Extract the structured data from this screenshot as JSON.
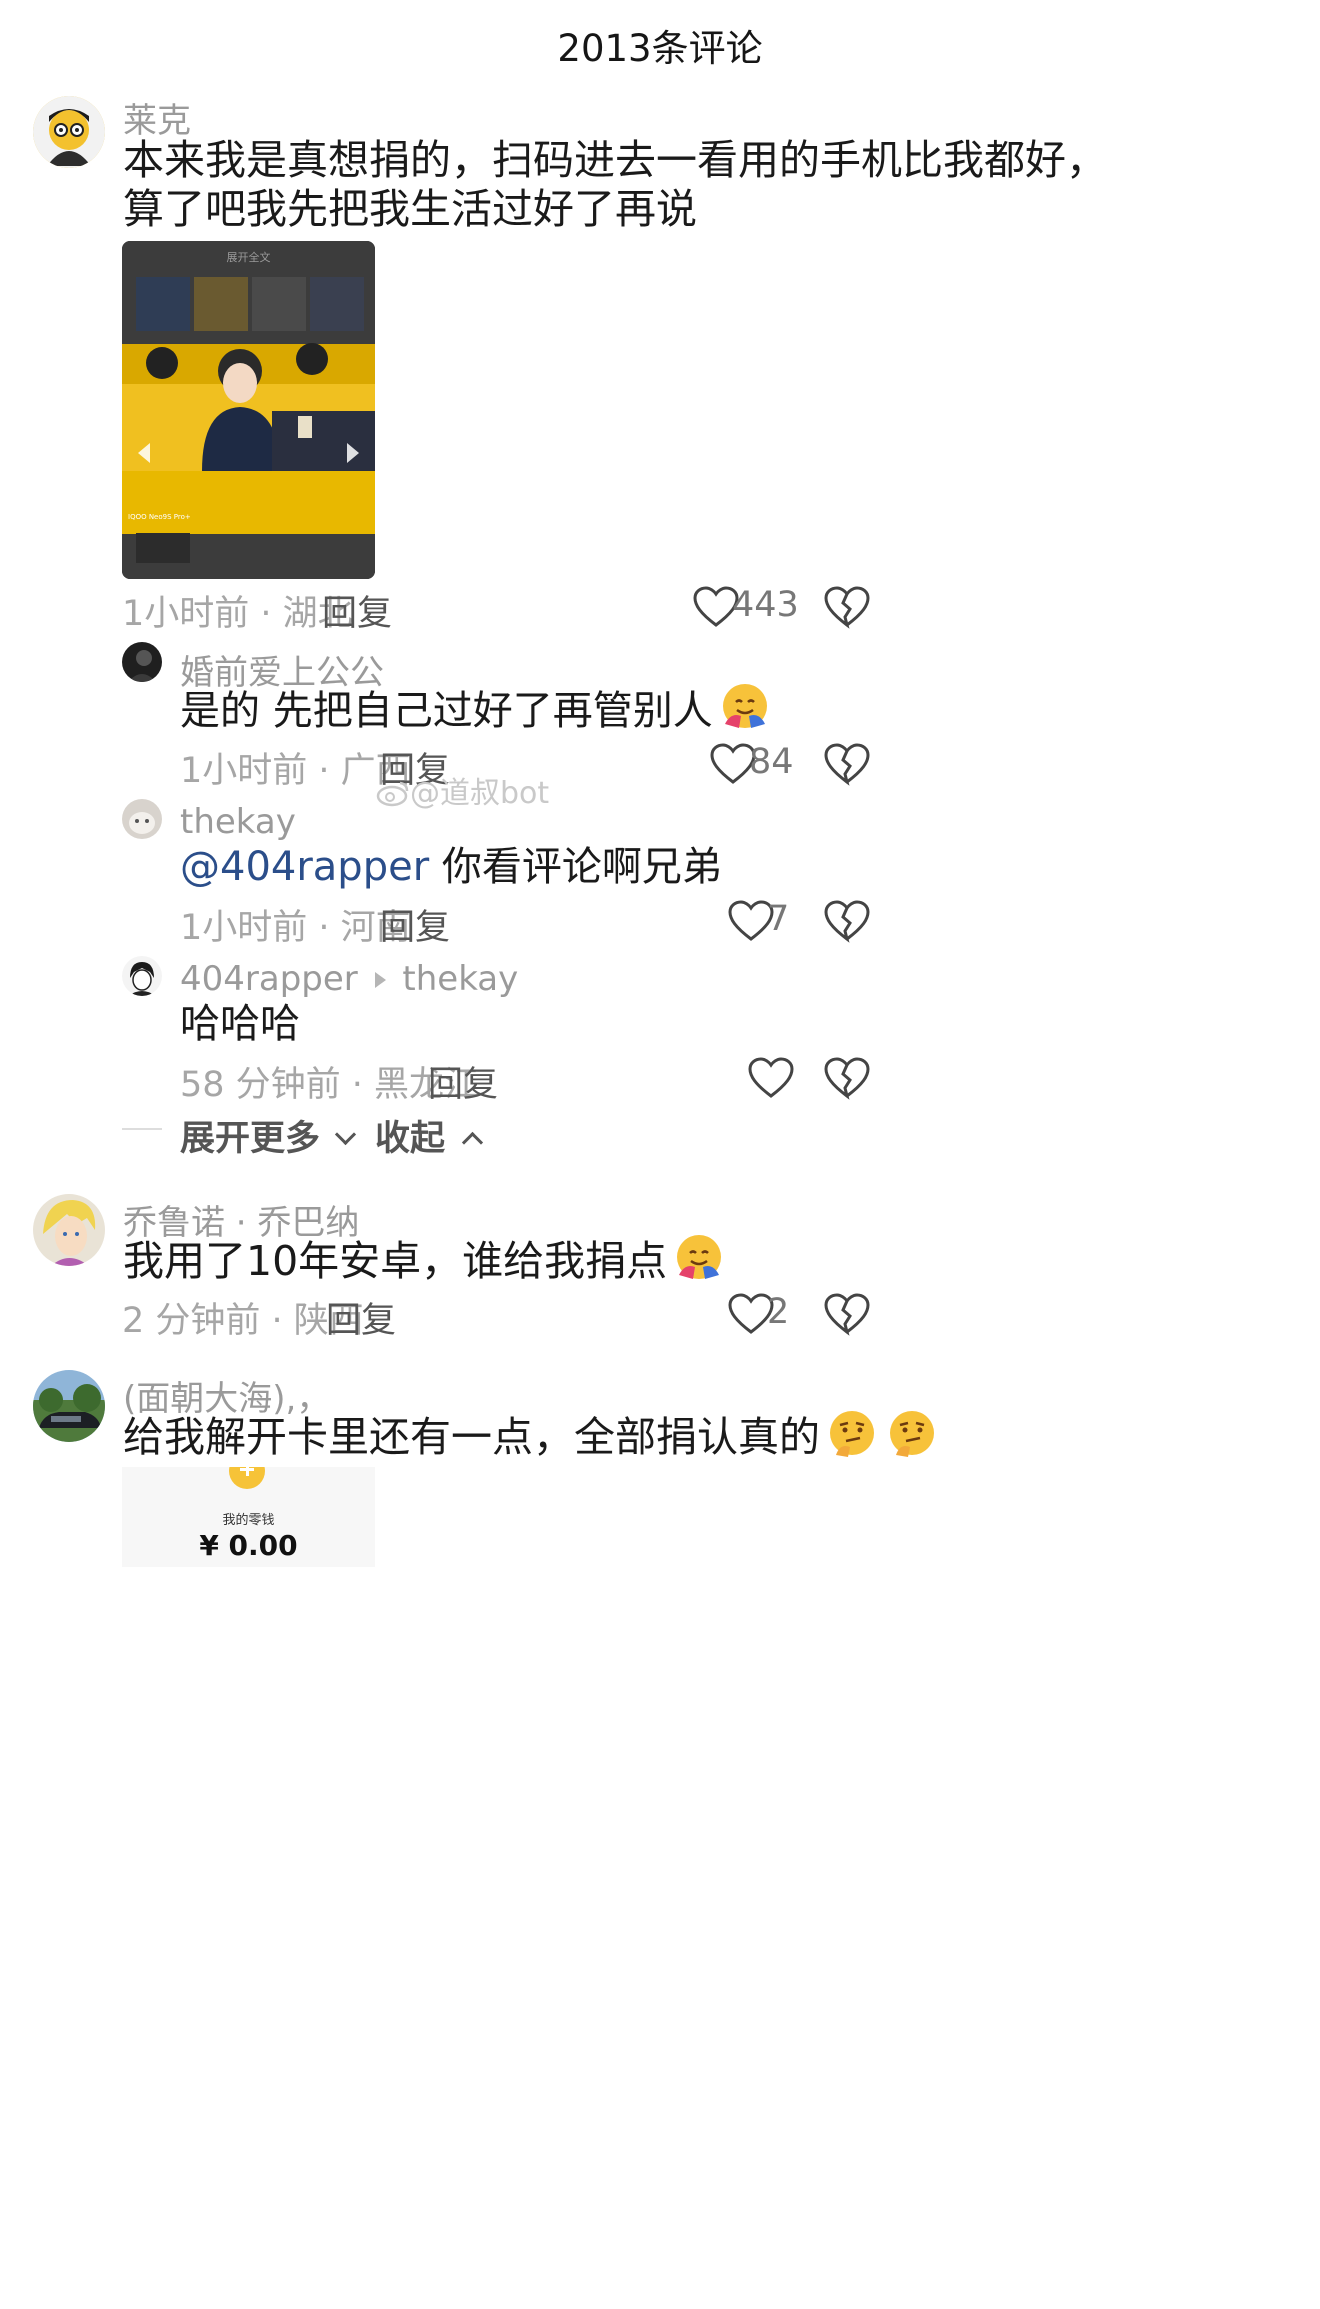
{
  "header": {
    "title": "2013条评论"
  },
  "comments": [
    {
      "user": "莱克",
      "text_lines": [
        "本来我是真想捐的，扫码进去一看用的手机比我都好，",
        "算了吧我先把我生活过好了再说"
      ],
      "time_location": "1小时前 · 湖北",
      "reply_label": "回复",
      "likes": "443",
      "image": {
        "top_caption": "展开全文",
        "bottom_caption": "IQOO Neo9S Pro+"
      }
    },
    {
      "user": "婚前爱上公公",
      "text": "是的 先把自己过好了再管别人",
      "time_location": "1小时前 · 广西",
      "reply_label": "回复",
      "likes": "84"
    },
    {
      "user": "thekay",
      "mention": "@404rapper",
      "text": " 你看评论啊兄弟",
      "time_location": "1小时前 · 河南",
      "reply_label": "回复",
      "likes": "7"
    },
    {
      "user": "404rapper",
      "reply_to": "thekay",
      "text": "哈哈哈",
      "time_location": "58 分钟前 · 黑龙江",
      "reply_label": "回复"
    },
    {
      "user": "乔鲁诺 · 乔巴纳",
      "text": "我用了10年安卓，谁给我捐点",
      "time_location": "2 分钟前 · 陕西",
      "reply_label": "回复",
      "likes": "2"
    },
    {
      "user": "(面朝大海),，",
      "text": "给我解开卡里还有一点，全部捐认真的",
      "wallet": {
        "label": "我的零钱",
        "amount": "¥ 0.00"
      }
    }
  ],
  "thread_controls": {
    "expand_more": "展开更多",
    "collapse": "收起"
  },
  "watermark": "@道叔bot",
  "colors": {
    "name_gray": "#9a9a9a",
    "mention_blue": "#2b4e8a",
    "photo_yellow": "#f0c020"
  }
}
